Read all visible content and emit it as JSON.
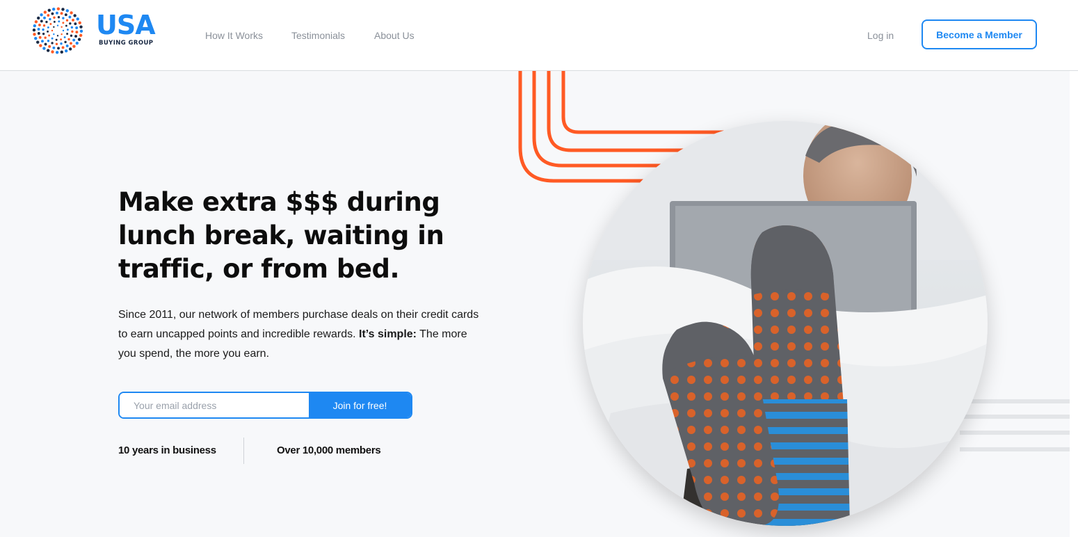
{
  "brand": {
    "name": "USA",
    "tagline": "BUYING GROUP",
    "colors": {
      "primary": "#1e88f2",
      "accent": "#ff5a24",
      "navy": "#1a2a44"
    }
  },
  "nav": {
    "links": [
      {
        "label": "How It Works"
      },
      {
        "label": "Testimonials"
      },
      {
        "label": "About Us"
      }
    ],
    "login_label": "Log in",
    "cta_label": "Become a Member"
  },
  "hero": {
    "headline": "Make extra $$$ during lunch break, waiting in traffic, or from bed.",
    "description_pre": "Since 2011, our network of members purchase deals on their credit cards to earn uncapped points and incredible rewards. ",
    "description_bold": "It’s simple:",
    "description_post": " The more you spend, the more you earn.",
    "signup": {
      "email_placeholder": "Your email address",
      "email_value": "",
      "button_label": "Join for free!"
    },
    "stats": [
      {
        "label": "10 years in business"
      },
      {
        "label": "Over 10,000 members"
      }
    ],
    "photo_icon": "man-in-bed-with-laptop-and-polka-dot-socks"
  }
}
